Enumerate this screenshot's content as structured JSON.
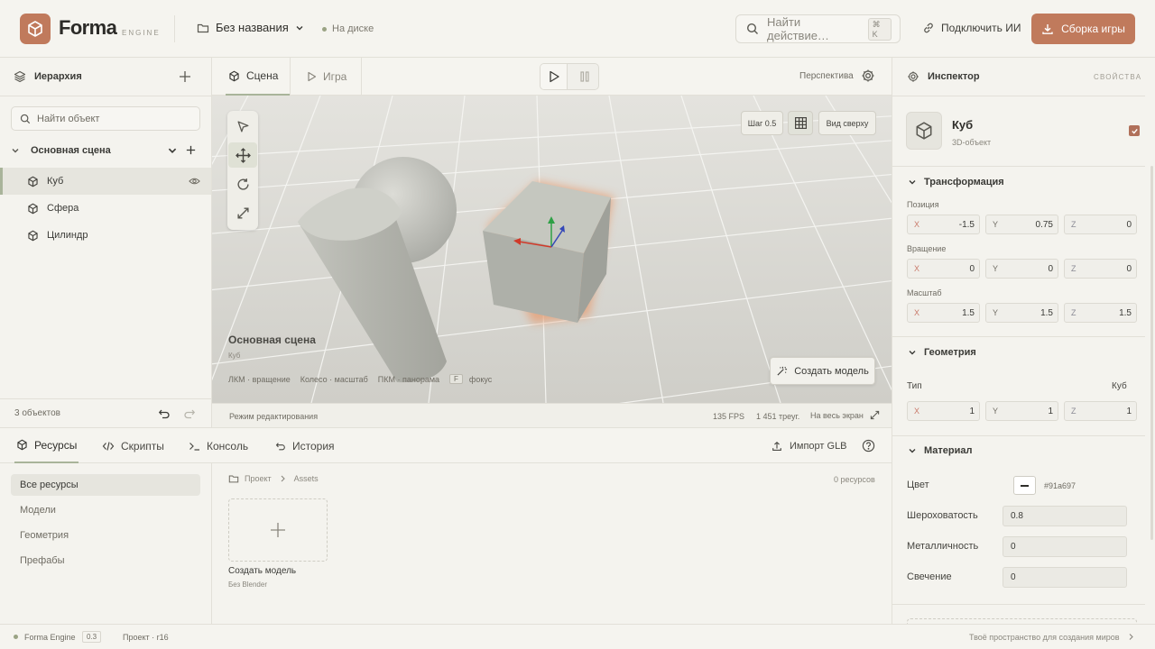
{
  "header": {
    "brand": "Forma",
    "brand_sub": "ENGINE",
    "project": "Без названия",
    "disk_status": "На диске",
    "search_placeholder": "Найти действие…",
    "kbd": "⌘ K",
    "ai_button": "Подключить ИИ",
    "build_button": "Сборка игры"
  },
  "hierarchy": {
    "title": "Иерархия",
    "search_placeholder": "Найти объект",
    "scene": "Основная сцена",
    "items": [
      "Куб",
      "Сфера",
      "Цилиндр"
    ],
    "count": "3 объектов"
  },
  "center": {
    "tabs": [
      "Сцена",
      "Игра"
    ],
    "perspective": "Перспектива",
    "step": "Шаг 0.5",
    "view_top": "Вид сверху",
    "scene_title": "Основная сцена",
    "scene_sub": "Куб",
    "hints": [
      "ЛКМ · вращение",
      "Колесо · масштаб",
      "ПКМ · панорама",
      "F",
      "фокус"
    ],
    "create_model": "Создать модель",
    "status_mode": "Режим редактирования",
    "fps": "135 FPS",
    "tris": "1 451 треуг.",
    "fullscreen": "На весь экран"
  },
  "bottom": {
    "tabs": [
      "Ресурсы",
      "Скрипты",
      "Консоль",
      "История"
    ],
    "import": "Импорт GLB",
    "side": [
      "Все ресурсы",
      "Модели",
      "Геометрия",
      "Префабы"
    ],
    "breadcrumb": [
      "Проект",
      "Assets"
    ],
    "res_count": "0 ресурсов",
    "tile_title": "Создать модель",
    "tile_sub": "Без Blender"
  },
  "inspector": {
    "title": "Инспектор",
    "subtitle": "СВОЙСТВА",
    "object_name": "Куб",
    "object_type": "3D-объект",
    "transform": {
      "title": "Трансформация",
      "position_label": "Позиция",
      "position": [
        "-1.5",
        "0.75",
        "0"
      ],
      "rotation_label": "Вращение",
      "rotation": [
        "0",
        "0",
        "0"
      ],
      "scale_label": "Масштаб",
      "scale": [
        "1.5",
        "1.5",
        "1.5"
      ]
    },
    "geometry": {
      "title": "Геометрия",
      "type_label": "Тип",
      "type_value": "Куб",
      "values": [
        "1",
        "1",
        "1"
      ]
    },
    "material": {
      "title": "Материал",
      "color_label": "Цвет",
      "color_value": "#91a697",
      "roughness_label": "Шероховатость",
      "roughness": "0.8",
      "metalness_label": "Металличность",
      "metalness": "0",
      "emission_label": "Свечение",
      "emission": "0"
    }
  },
  "footer": {
    "engine": "Forma Engine",
    "version": "0.3",
    "project": "Проект · r16",
    "tagline": "Твоё пространство для создания миров"
  },
  "colors": {
    "accent": "#c07a5c",
    "sage": "#a9b49a",
    "background": "#f4f3ee",
    "viewport": "#d5d4ce"
  }
}
